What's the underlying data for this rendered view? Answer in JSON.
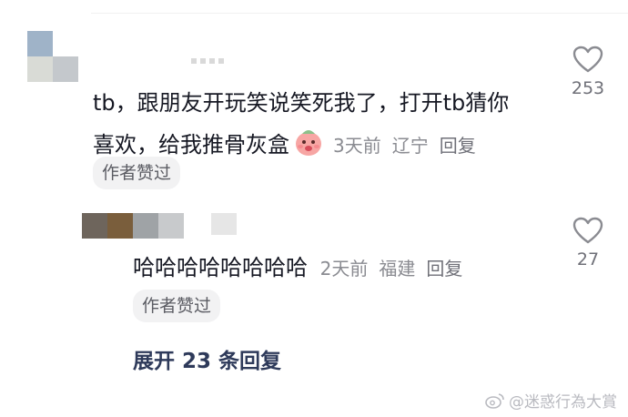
{
  "comment": {
    "text": "tb，跟朋友开玩笑说笑死我了，打开tb猜你喜欢，给我推骨灰盒",
    "line1": "tb，跟朋友开玩笑说笑死我了，打开tb猜你",
    "line2": "喜欢，给我推骨灰盒",
    "emoji": "sticker-emoji",
    "time": "3天前",
    "location": "辽宁",
    "reply_label": "回复",
    "likes": "253",
    "author_badge": "作者赞过"
  },
  "reply": {
    "text": "哈哈哈哈哈哈哈哈",
    "time": "2天前",
    "location": "福建",
    "reply_label": "回复",
    "likes": "27",
    "author_badge": "作者赞过"
  },
  "expand": {
    "label": "展开 23 条回复"
  },
  "watermark": {
    "text": "@迷惑行為大賞",
    "icon": "weibo-icon"
  },
  "colors": {
    "text": "#161823",
    "meta": "#8a8b91",
    "expand": "#2e3a5a",
    "badge_bg": "#f2f2f3"
  }
}
